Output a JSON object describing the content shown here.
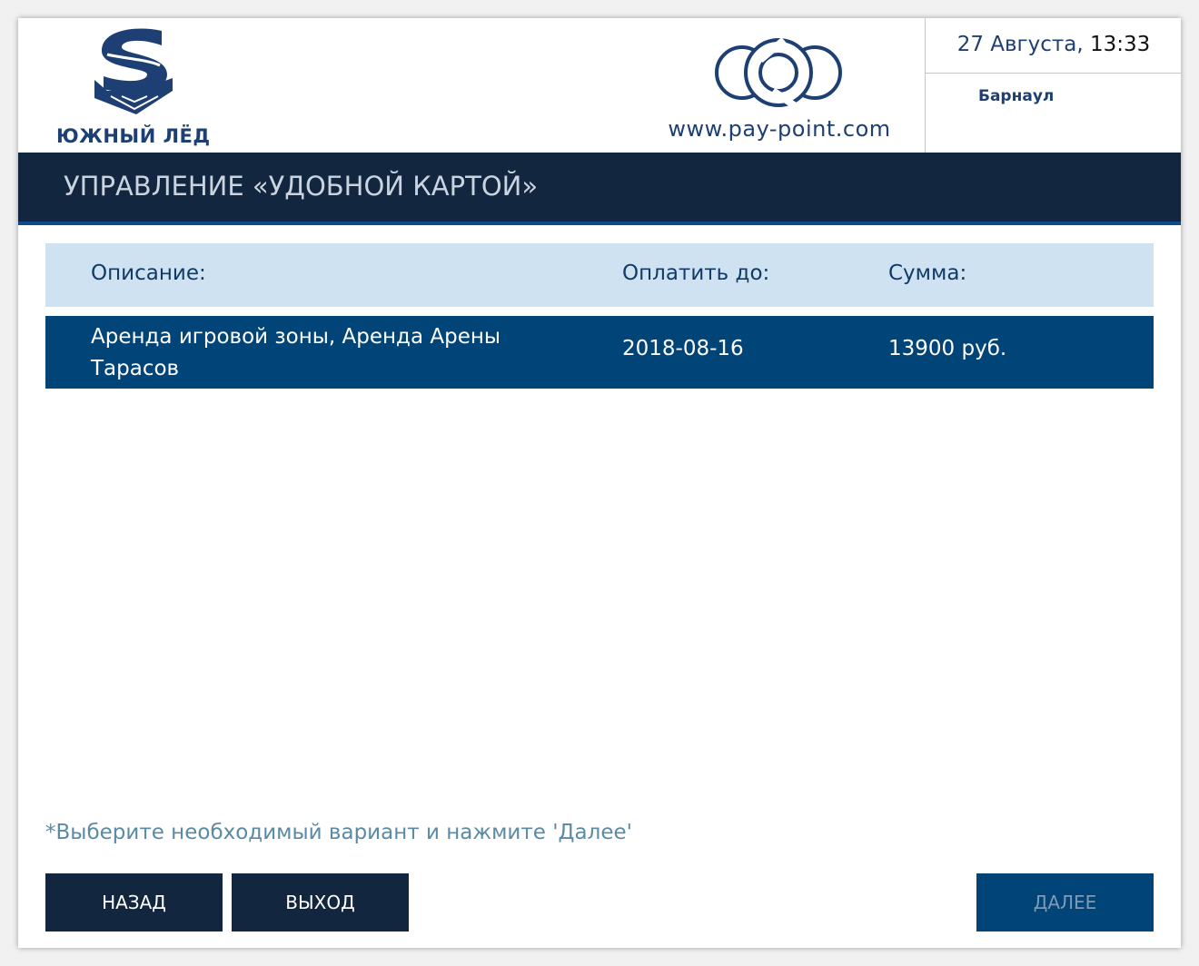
{
  "header": {
    "brand_name": "ЮЖНЫЙ ЛЁД",
    "provider_url": "www.pay-point.com",
    "date": "27 Августа,",
    "time": "13:33",
    "city": "Барнаул"
  },
  "titlebar": {
    "title": "УПРАВЛЕНИЕ «УДОБНОЙ КАРТОЙ»"
  },
  "table": {
    "columns": [
      "Описание:",
      "Оплатить до:",
      "Сумма:"
    ],
    "rows": [
      {
        "description": "Аренда игровой зоны, Аренда Арены Тарасов",
        "due_date": "2018-08-16",
        "amount": "13900 руб.",
        "selected": true
      }
    ]
  },
  "hint": "*Выберите необходимый вариант и нажмите 'Далее'",
  "buttons": {
    "back": "НАЗАД",
    "exit": "ВЫХОД",
    "next": "ДАЛЕЕ"
  },
  "colors": {
    "navy": "#13263f",
    "selected_row": "#004478",
    "header_row": "#cfe2f1",
    "brand": "#1e3f73",
    "hint": "#5a8aa5"
  },
  "icons": {
    "brand": "south-ice-s-logo",
    "provider": "pay-point-logo"
  }
}
